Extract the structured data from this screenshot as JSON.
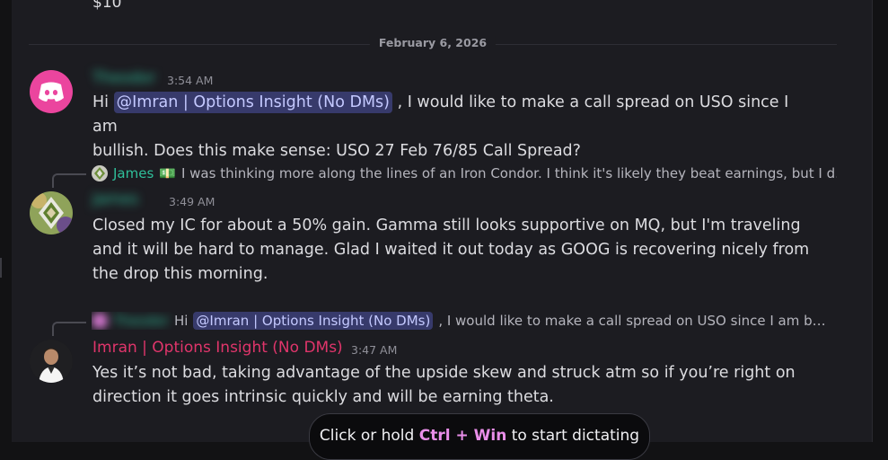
{
  "previous": {
    "tail_text": "$10"
  },
  "date_divider": "February 6, 2026",
  "messages": [
    {
      "author": "Theodor",
      "time": "3:54 AM",
      "mention": "@Imran | Options Insight (No DMs)",
      "text_line1": ", I would like to make a call spread on USO since I am",
      "text_line2": "bullish. Does this make sense: USO 27 Feb 76/85 Call Spread?",
      "avatar_icon": "discord-logo-icon",
      "avatar_color": "#eb459e"
    },
    {
      "reply": {
        "author": "James",
        "emoji": "💵",
        "text": "I was thinking more along the lines of an Iron Condor. I think it's likely they beat earnings, but I d…"
      },
      "author": "James",
      "time": "3:49 AM",
      "text": "Closed my IC for about a 50% gain. Gamma still looks supportive on MQ, but I'm traveling and it will be hard to manage. Glad I waited it out today as GOOG is recovering nicely from the drop this morning."
    },
    {
      "reply": {
        "author": "Theodor",
        "lead": "Hi",
        "mention": "@Imran | Options Insight (No DMs)",
        "text": ", I would like to make a call spread on USO since I am b…"
      },
      "author": "Imran | Options Insight (No DMs)",
      "author_color": "#e0356b",
      "time": "3:47 AM",
      "text": "Yes it’s not bad, taking advantage of the upside skew and struck atm so if you’re right on direction it goes intrinsic quickly and will be earning theta."
    }
  ],
  "dictation": {
    "prefix": "Click or hold",
    "shortcut": "Ctrl + Win",
    "suffix": "to start dictating"
  }
}
